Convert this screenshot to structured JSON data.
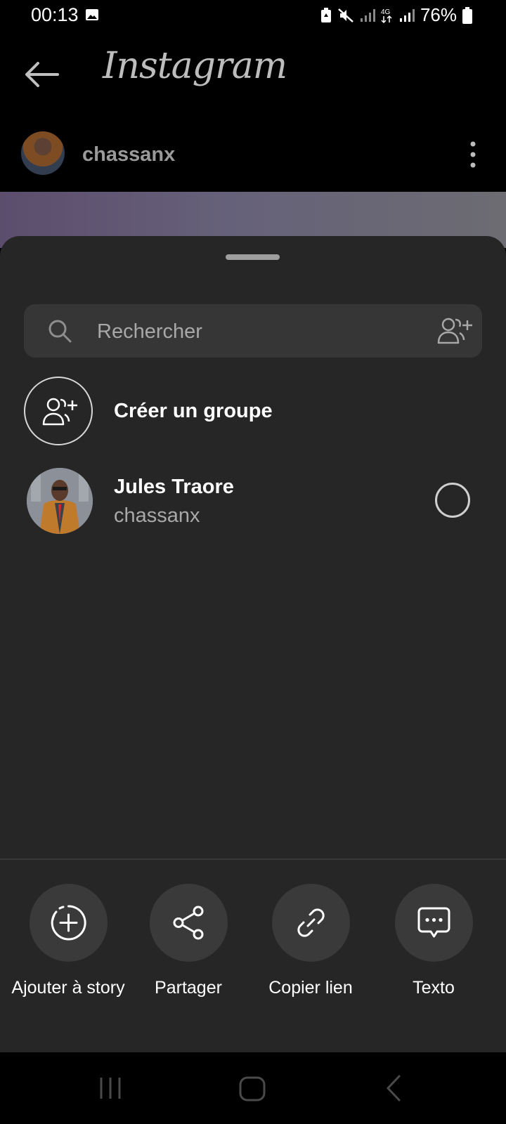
{
  "status_bar": {
    "time": "00:13",
    "battery": "76%"
  },
  "app": {
    "logo_text": "Instagram",
    "post_username": "chassanx"
  },
  "share_sheet": {
    "search": {
      "placeholder": "Rechercher",
      "value": ""
    },
    "create_group_label": "Créer un groupe",
    "contacts": [
      {
        "name": "Jules Traore",
        "handle": "chassanx",
        "selected": false
      }
    ],
    "actions": [
      {
        "label": "Ajouter à story",
        "icon": "add-to-story-icon"
      },
      {
        "label": "Partager",
        "icon": "share-icon"
      },
      {
        "label": "Copier lien",
        "icon": "link-icon"
      },
      {
        "label": "Texto",
        "icon": "message-icon"
      }
    ]
  },
  "colors": {
    "sheet_background": "#262626",
    "search_background": "#363636",
    "action_circle": "#3a3a3a",
    "secondary_text": "#a8a8a8"
  }
}
